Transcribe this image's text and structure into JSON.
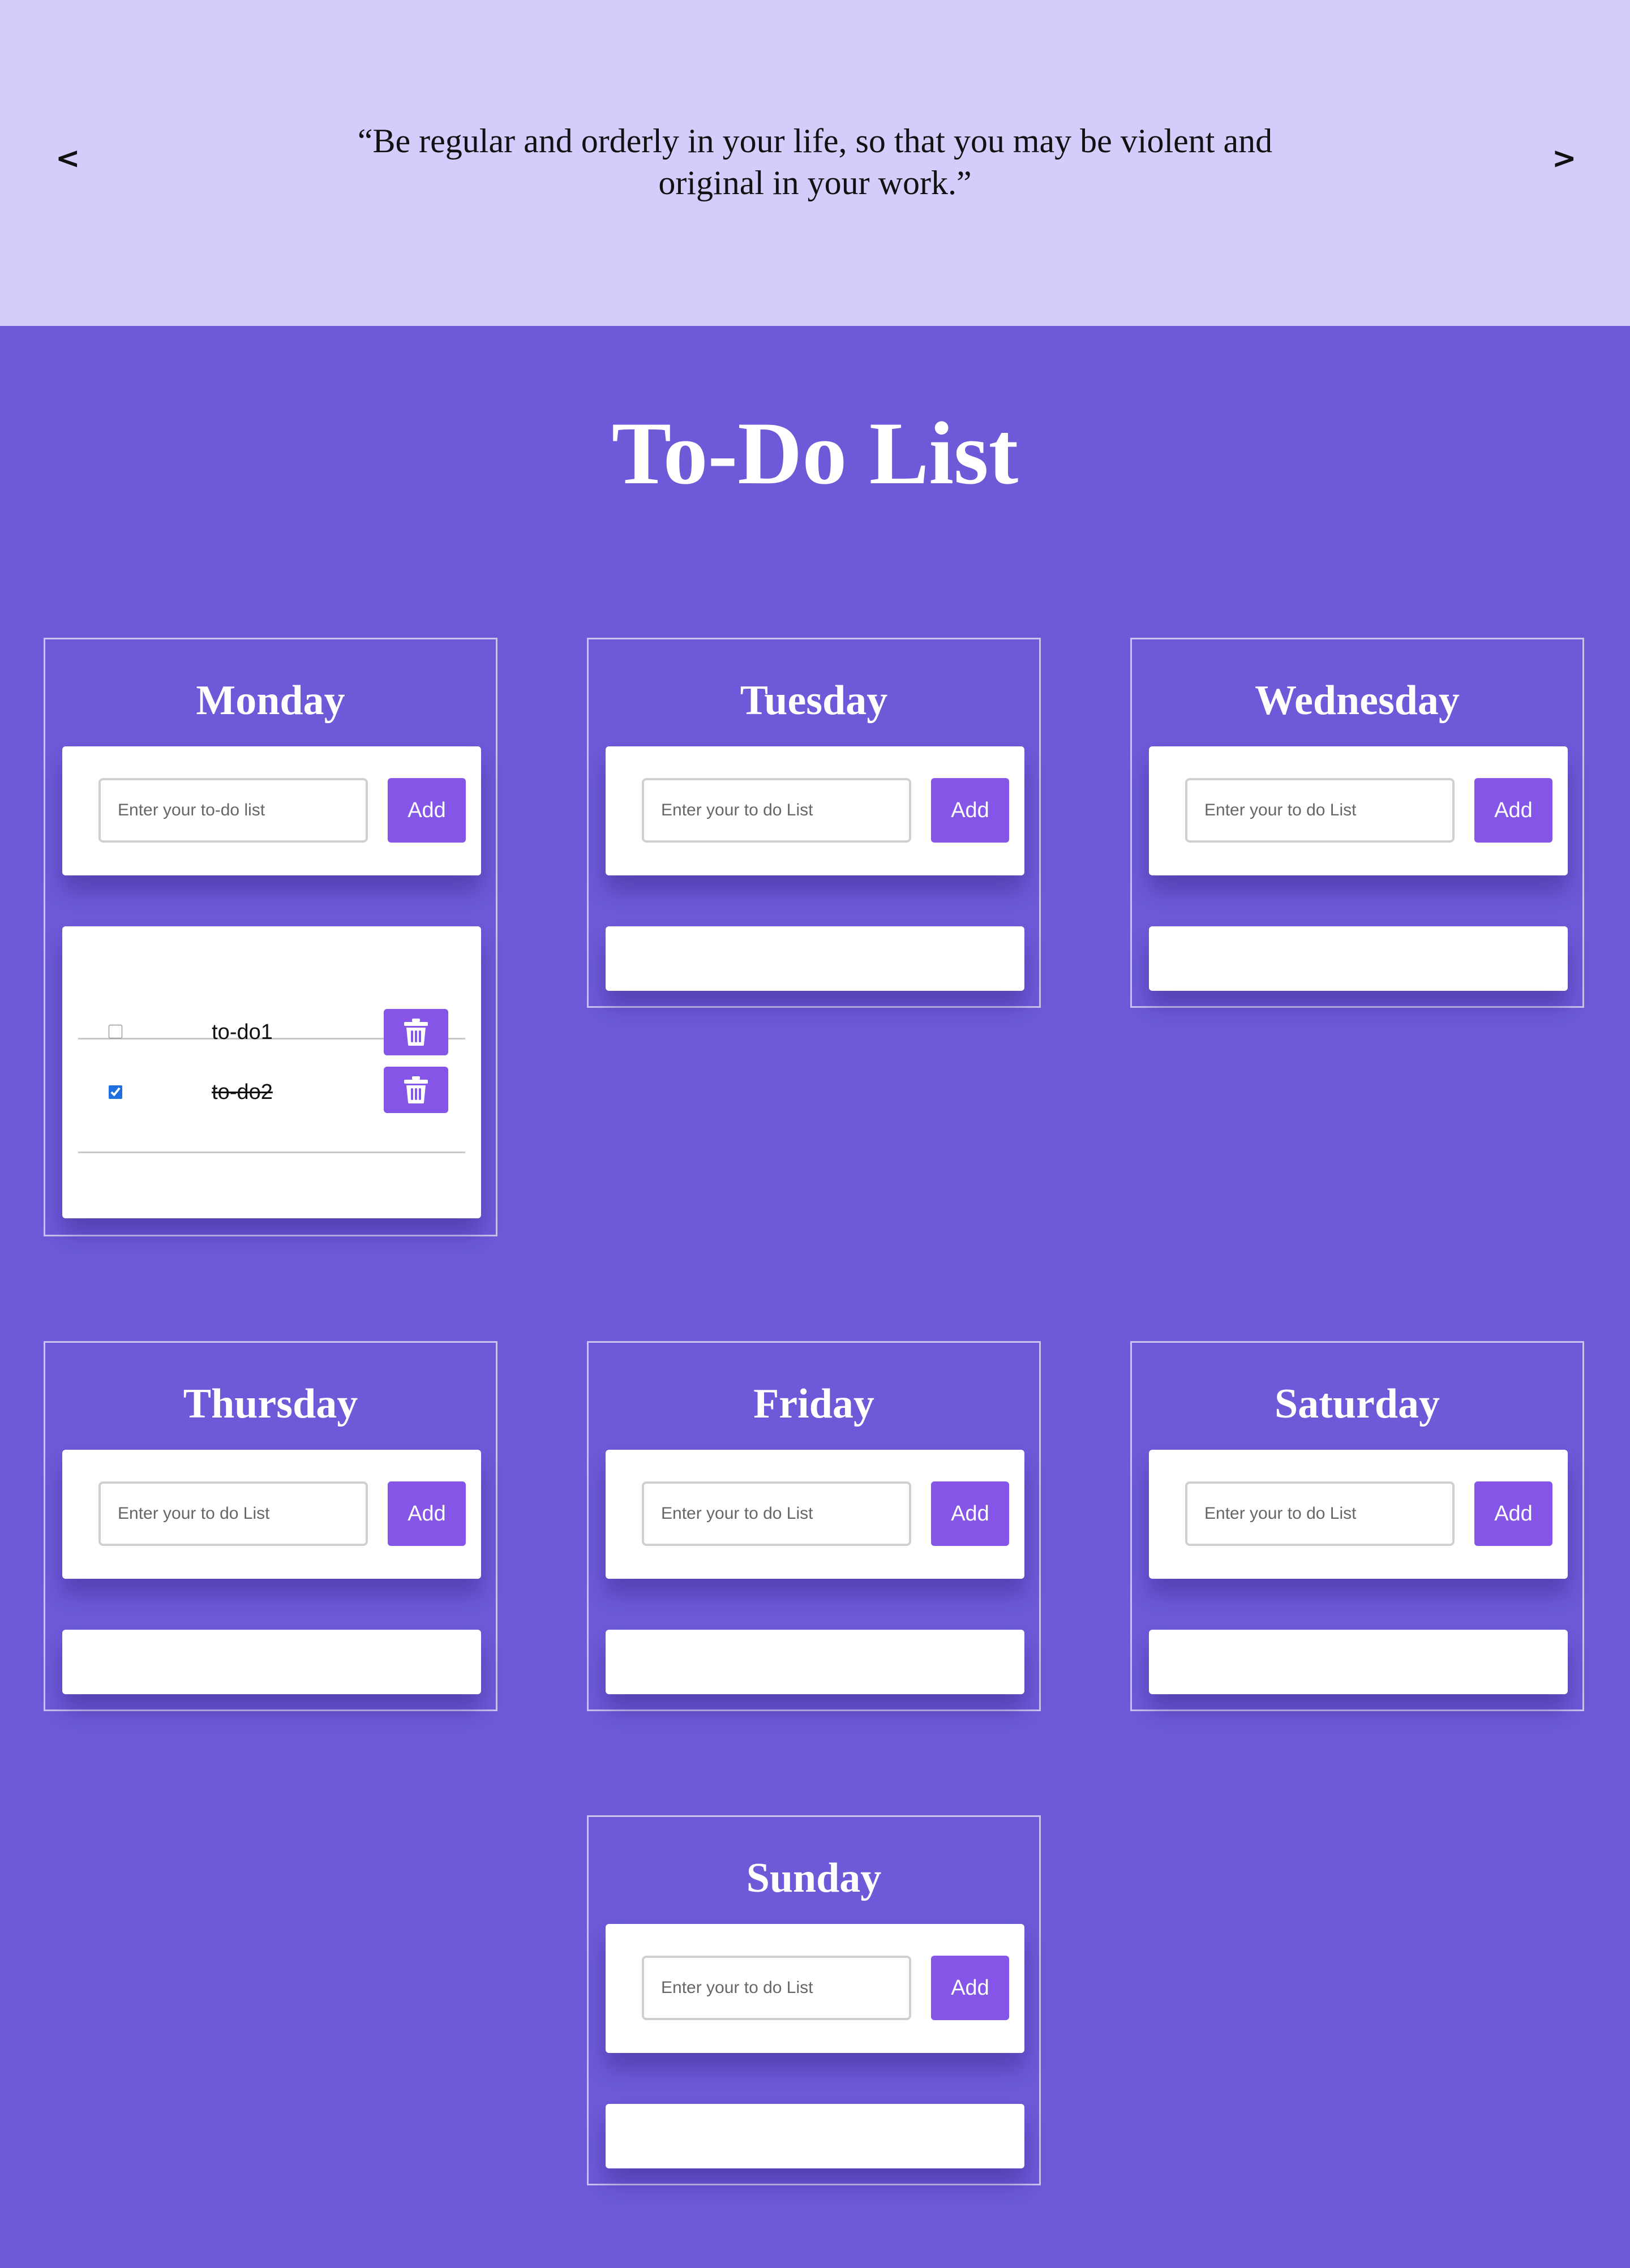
{
  "quote": {
    "prev_label": "<",
    "next_label": ">",
    "line1": "“Be regular and orderly in your life, so that you may be violent and",
    "line2": "original in your work.”"
  },
  "page_title": "To-Do List",
  "add_label": "Add",
  "days": [
    {
      "name": "Monday",
      "placeholder": "Enter your to-do list",
      "todos": [
        {
          "text": "to-do1",
          "done": false
        },
        {
          "text": "to-do2",
          "done": true
        }
      ]
    },
    {
      "name": "Tuesday",
      "placeholder": "Enter your to do List",
      "todos": []
    },
    {
      "name": "Wednesday",
      "placeholder": "Enter your to do List",
      "todos": []
    },
    {
      "name": "Thursday",
      "placeholder": "Enter your to do List",
      "todos": []
    },
    {
      "name": "Friday",
      "placeholder": "Enter your to do List",
      "todos": []
    },
    {
      "name": "Saturday",
      "placeholder": "Enter your to do List",
      "todos": []
    },
    {
      "name": "Sunday",
      "placeholder": "Enter your to do List",
      "todos": []
    }
  ],
  "colors": {
    "page_bg": "#6c5ad9",
    "quote_bg": "#d4cdfc",
    "button": "#8455e7",
    "panel": "#ffffff"
  }
}
